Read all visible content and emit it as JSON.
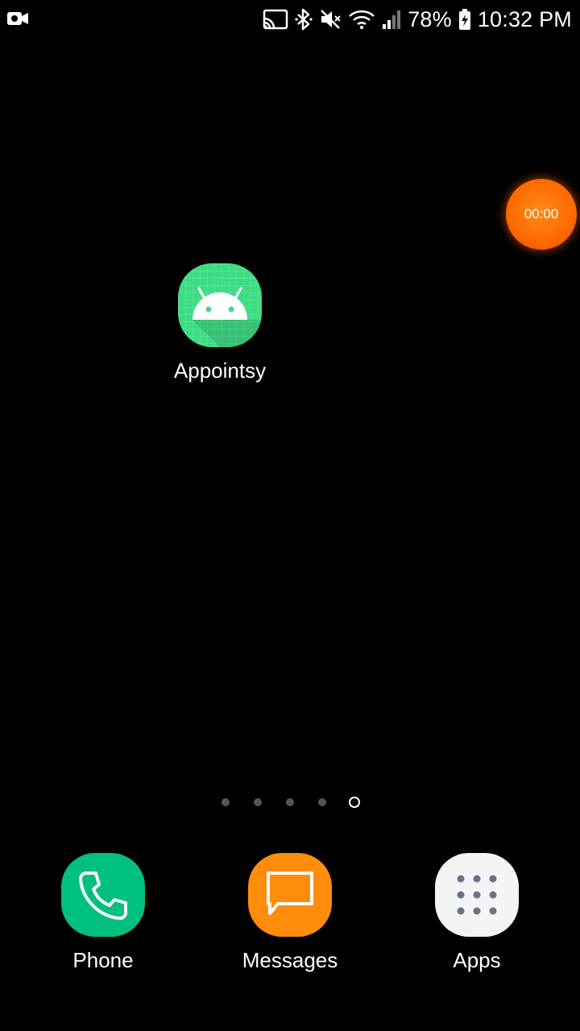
{
  "status_bar": {
    "left_icon": "screen-record-icon",
    "right_icons": [
      "cast-icon",
      "bluetooth-icon",
      "mute-icon",
      "wifi-icon",
      "signal-icon"
    ],
    "battery_percent": "78%",
    "battery_icon": "battery-charging-icon",
    "time": "10:32 PM"
  },
  "recording_timer": {
    "text": "00:00",
    "color": "#ff6a00"
  },
  "home_apps": [
    {
      "label": "Appointsy",
      "icon": "android-icon",
      "color": "#3ddc84"
    }
  ],
  "page_indicator": {
    "count": 5,
    "active_index": 4
  },
  "dock": [
    {
      "label": "Phone",
      "icon": "phone-icon",
      "color": "#00c07f"
    },
    {
      "label": "Messages",
      "icon": "message-icon",
      "color": "#ff8c0a"
    },
    {
      "label": "Apps",
      "icon": "apps-grid-icon",
      "color": "#f4f4f4"
    }
  ]
}
